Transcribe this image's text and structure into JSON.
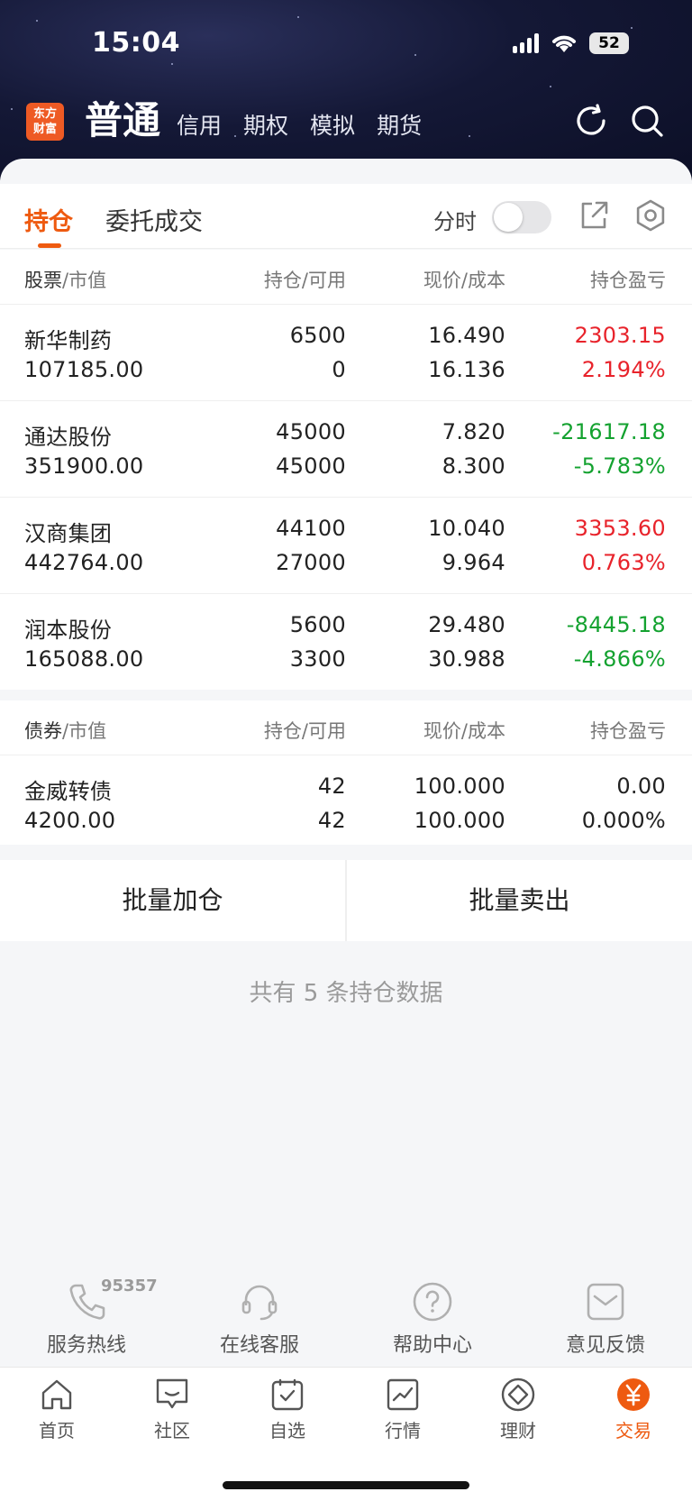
{
  "status_bar": {
    "time": "15:04",
    "battery": "52"
  },
  "header": {
    "logo_text": "东方财富",
    "account_tabs": [
      "普通",
      "信用",
      "期权",
      "模拟",
      "期货"
    ]
  },
  "card": {
    "tab_holdings": "持仓",
    "tab_orders": "委托成交",
    "timeshare_label": "分时"
  },
  "stocks": {
    "headers": [
      "股票",
      "/市值",
      "持仓/可用",
      "现价/成本",
      "持仓盈亏"
    ],
    "rows": [
      {
        "name": "新华制药",
        "market_value": "107185.00",
        "position": "6500",
        "available": "0",
        "price": "16.490",
        "cost": "16.136",
        "pnl": "2303.15",
        "pnl_pct": "2.194%",
        "trend": "up"
      },
      {
        "name": "通达股份",
        "market_value": "351900.00",
        "position": "45000",
        "available": "45000",
        "price": "7.820",
        "cost": "8.300",
        "pnl": "-21617.18",
        "pnl_pct": "-5.783%",
        "trend": "down"
      },
      {
        "name": "汉商集团",
        "market_value": "442764.00",
        "position": "44100",
        "available": "27000",
        "price": "10.040",
        "cost": "9.964",
        "pnl": "3353.60",
        "pnl_pct": "0.763%",
        "trend": "up"
      },
      {
        "name": "润本股份",
        "market_value": "165088.00",
        "position": "5600",
        "available": "3300",
        "price": "29.480",
        "cost": "30.988",
        "pnl": "-8445.18",
        "pnl_pct": "-4.866%",
        "trend": "down"
      }
    ]
  },
  "bonds": {
    "headers": [
      "债券",
      "/市值",
      "持仓/可用",
      "现价/成本",
      "持仓盈亏"
    ],
    "rows": [
      {
        "name": "金威转债",
        "market_value": "4200.00",
        "position": "42",
        "available": "42",
        "price": "100.000",
        "cost": "100.000",
        "pnl": "0.00",
        "pnl_pct": "0.000%",
        "trend": "flat"
      }
    ]
  },
  "actions": {
    "batch_add": "批量加仓",
    "batch_sell": "批量卖出"
  },
  "summary": "共有 5 条持仓数据",
  "services": {
    "hotline_number": "95357",
    "items": [
      "服务热线",
      "在线客服",
      "帮助中心",
      "意见反馈"
    ]
  },
  "tabbar": {
    "items": [
      "首页",
      "社区",
      "自选",
      "行情",
      "理财",
      "交易"
    ],
    "active": "交易"
  },
  "colors": {
    "accent": "#ee5a10",
    "up": "#e8232b",
    "down": "#14a230"
  }
}
